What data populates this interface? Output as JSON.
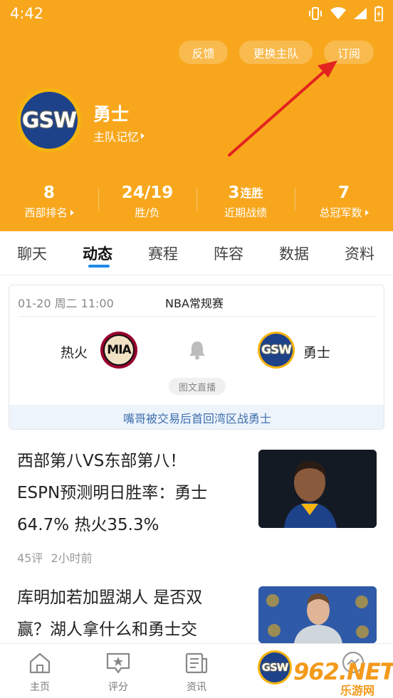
{
  "status_bar": {
    "time": "4:42"
  },
  "header": {
    "buttons": {
      "feedback": "反馈",
      "switch_team": "更换主队",
      "subscribe": "订阅"
    },
    "team": {
      "logo_text": "GSW",
      "name": "勇士",
      "memory_link": "主队记忆"
    },
    "stats": [
      {
        "value": "8",
        "unit": "",
        "label": "西部排名",
        "has_arrow": true
      },
      {
        "value": "24/19",
        "unit": "",
        "label": "胜/负",
        "has_arrow": false
      },
      {
        "value": "3",
        "unit": "连胜",
        "label": "近期战绩",
        "has_arrow": false
      },
      {
        "value": "7",
        "unit": "",
        "label": "总冠军数",
        "has_arrow": true
      }
    ]
  },
  "tabs": [
    "聊天",
    "动态",
    "赛程",
    "阵容",
    "数据",
    "资料"
  ],
  "active_tab": "动态",
  "match_card": {
    "date": "01-20 周二 11:00",
    "league": "NBA常规赛",
    "home": {
      "name": "热火",
      "logo_text": "MIA"
    },
    "away": {
      "name": "勇士",
      "logo_text": "GSW"
    },
    "badge": "图文直播",
    "footer": "嘴哥被交易后首回湾区战勇士"
  },
  "news": [
    {
      "title_lines": [
        "西部第八VS东部第八！",
        "ESPN预测明日胜率：勇士",
        "64.7% 热火35.3%"
      ],
      "comments": "45评",
      "time": "2小时前"
    },
    {
      "title_lines": [
        "库明加若加盟湖人 是否双",
        "赢？湖人拿什么和勇士交"
      ],
      "comments": "",
      "time": ""
    }
  ],
  "bottom_nav": {
    "home": "主页",
    "rating": "评分",
    "news": "资讯",
    "team_logo_text": "GSW"
  },
  "watermark": {
    "main": "962.NET",
    "sub": "乐游网"
  },
  "colors": {
    "header_bg": "#f8a71d",
    "accent_blue": "#1e8ae6",
    "warriors_blue": "#1d428a",
    "warriors_gold": "#f5b40f",
    "heat_red": "#98002e"
  }
}
